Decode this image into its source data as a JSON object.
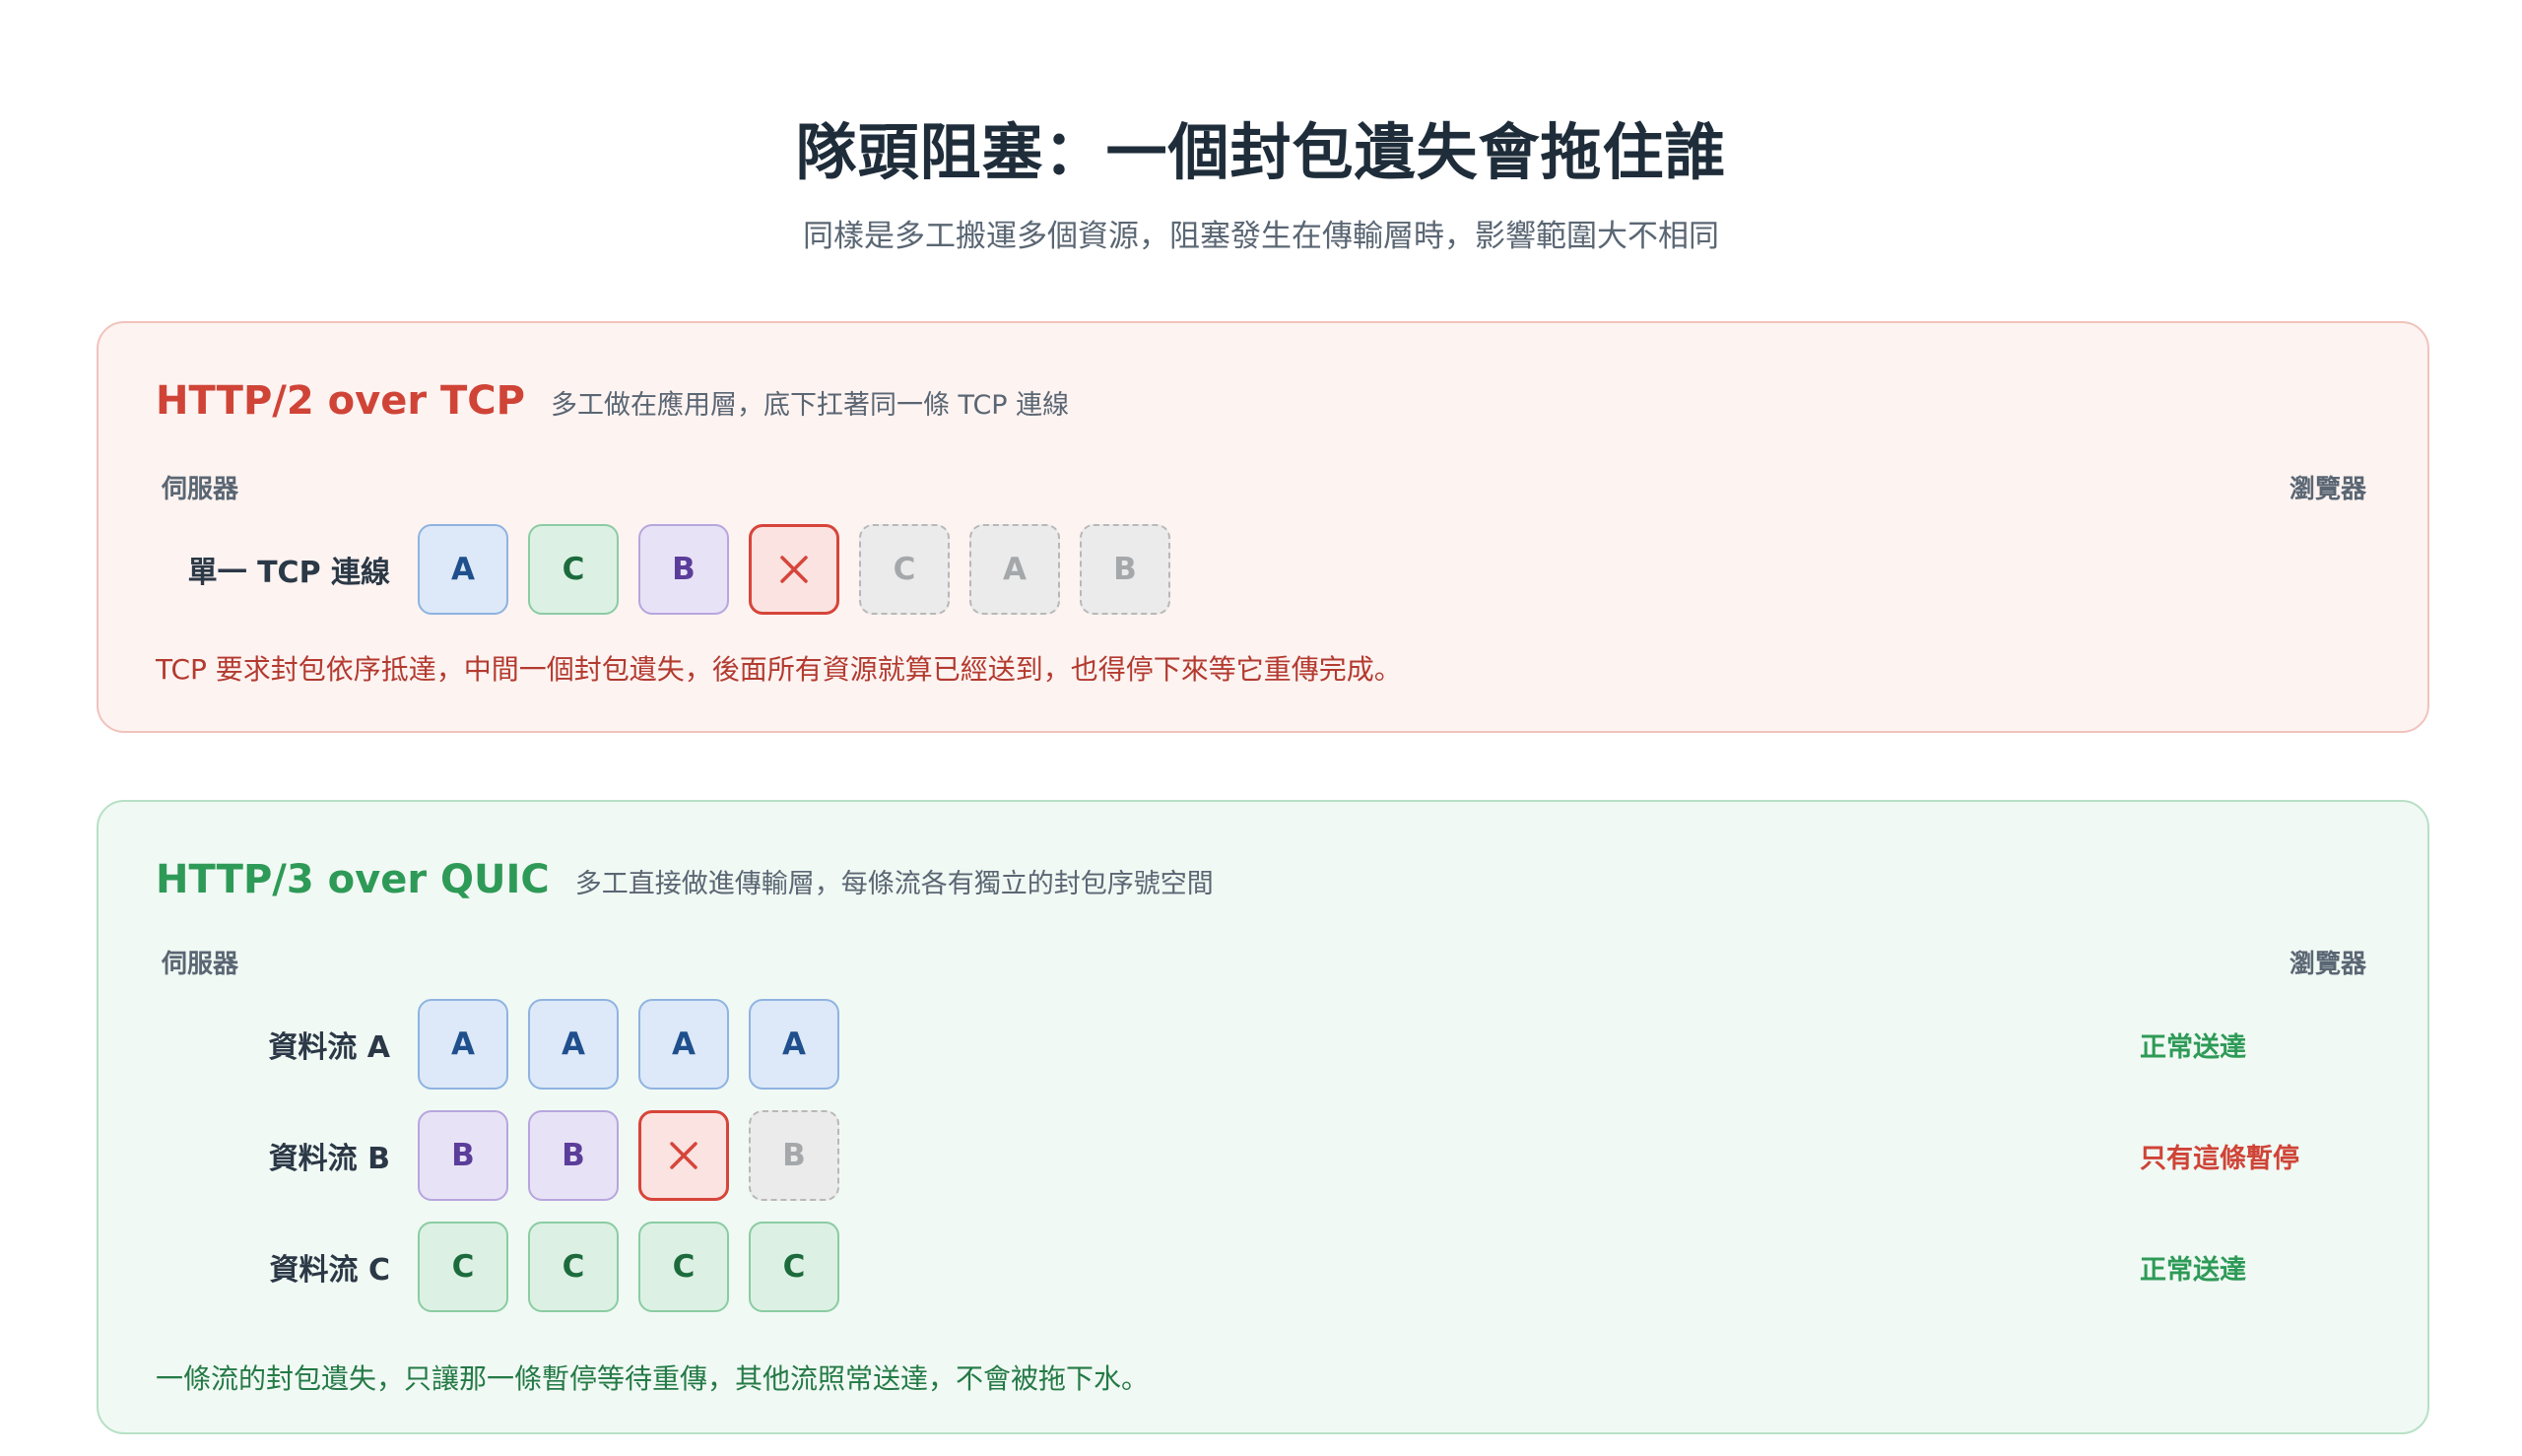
{
  "title": "隊頭阻塞：一個封包遺失會拖住誰",
  "subtitle": "同樣是多工搬運多個資源，阻塞發生在傳輸層時，影響範圍大不相同",
  "colors": {
    "tcp_accent": "#cf4437",
    "quic_accent": "#2e9a57",
    "stream_a": "#1f4f8c",
    "stream_b": "#5b3d9a",
    "stream_c": "#1d6b3d",
    "lost": "#d6453a",
    "waiting": "#a5a8ab"
  },
  "tcp_panel": {
    "title": "HTTP/2 over TCP",
    "description": "多工做在應用層，底下扛著同一條 TCP 連線",
    "server_label": "伺服器",
    "browser_label": "瀏覽器",
    "row": {
      "label": "單一 TCP 連線",
      "packets": [
        {
          "label": "A",
          "stream": "A",
          "state": "delivered"
        },
        {
          "label": "C",
          "stream": "C",
          "state": "delivered"
        },
        {
          "label": "B",
          "stream": "B",
          "state": "delivered"
        },
        {
          "label": "",
          "stream": "",
          "state": "lost",
          "icon": "close-icon"
        },
        {
          "label": "C",
          "stream": "C",
          "state": "waiting"
        },
        {
          "label": "A",
          "stream": "A",
          "state": "waiting"
        },
        {
          "label": "B",
          "stream": "B",
          "state": "waiting"
        }
      ]
    },
    "note": "TCP 要求封包依序抵達，中間一個封包遺失，後面所有資源就算已經送到，也得停下來等它重傳完成。"
  },
  "quic_panel": {
    "title": "HTTP/3 over QUIC",
    "description": "多工直接做進傳輸層，每條流各有獨立的封包序號空間",
    "server_label": "伺服器",
    "browser_label": "瀏覽器",
    "rows": [
      {
        "label": "資料流 A",
        "status": "正常送達",
        "status_type": "ok",
        "packets": [
          {
            "label": "A",
            "stream": "A",
            "state": "delivered"
          },
          {
            "label": "A",
            "stream": "A",
            "state": "delivered"
          },
          {
            "label": "A",
            "stream": "A",
            "state": "delivered"
          },
          {
            "label": "A",
            "stream": "A",
            "state": "delivered"
          }
        ]
      },
      {
        "label": "資料流 B",
        "status": "只有這條暫停",
        "status_type": "blocked",
        "packets": [
          {
            "label": "B",
            "stream": "B",
            "state": "delivered"
          },
          {
            "label": "B",
            "stream": "B",
            "state": "delivered"
          },
          {
            "label": "",
            "stream": "",
            "state": "lost",
            "icon": "close-icon"
          },
          {
            "label": "B",
            "stream": "B",
            "state": "waiting"
          }
        ]
      },
      {
        "label": "資料流 C",
        "status": "正常送達",
        "status_type": "ok",
        "packets": [
          {
            "label": "C",
            "stream": "C",
            "state": "delivered"
          },
          {
            "label": "C",
            "stream": "C",
            "state": "delivered"
          },
          {
            "label": "C",
            "stream": "C",
            "state": "delivered"
          },
          {
            "label": "C",
            "stream": "C",
            "state": "delivered"
          }
        ]
      }
    ],
    "note": "一條流的封包遺失，只讓那一條暫停等待重傳，其他流照常送達，不會被拖下水。"
  }
}
